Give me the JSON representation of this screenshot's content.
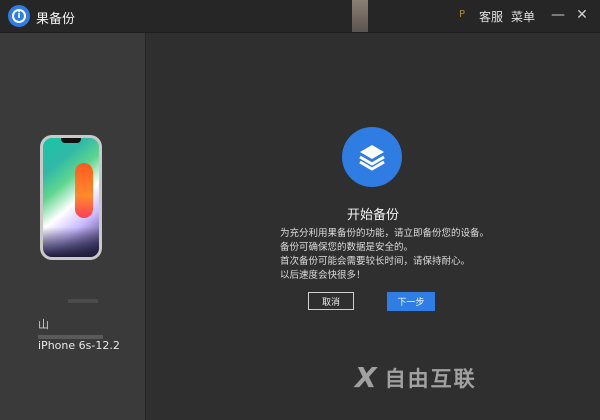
{
  "window": {
    "title": "果备份",
    "nav": [
      "客服",
      "菜单"
    ],
    "hint_glyph": "P",
    "controls": {
      "minimize": "—",
      "close": "✕"
    }
  },
  "sidebar": {
    "device_glyph": "山",
    "device_name": "iPhone 6s-12.2"
  },
  "main": {
    "heading": "开始备份",
    "description": [
      "为充分利用果备份的功能，请立即备份您的设备。",
      "备份可确保您的数据是安全的。",
      "首次备份可能会需要较长时间，请保持耐心。",
      "以后速度会快很多！"
    ],
    "cancel_label": "取消",
    "next_label": "下一步"
  },
  "watermark": {
    "glyph": "X",
    "text": "自由互联"
  },
  "icons": [
    "app-logo-icon",
    "layers-icon",
    "minimize-icon",
    "close-icon"
  ],
  "colors": {
    "accent": "#2e7ee6",
    "background": "#2f2f2f",
    "sidebar": "#3a3a3a"
  }
}
